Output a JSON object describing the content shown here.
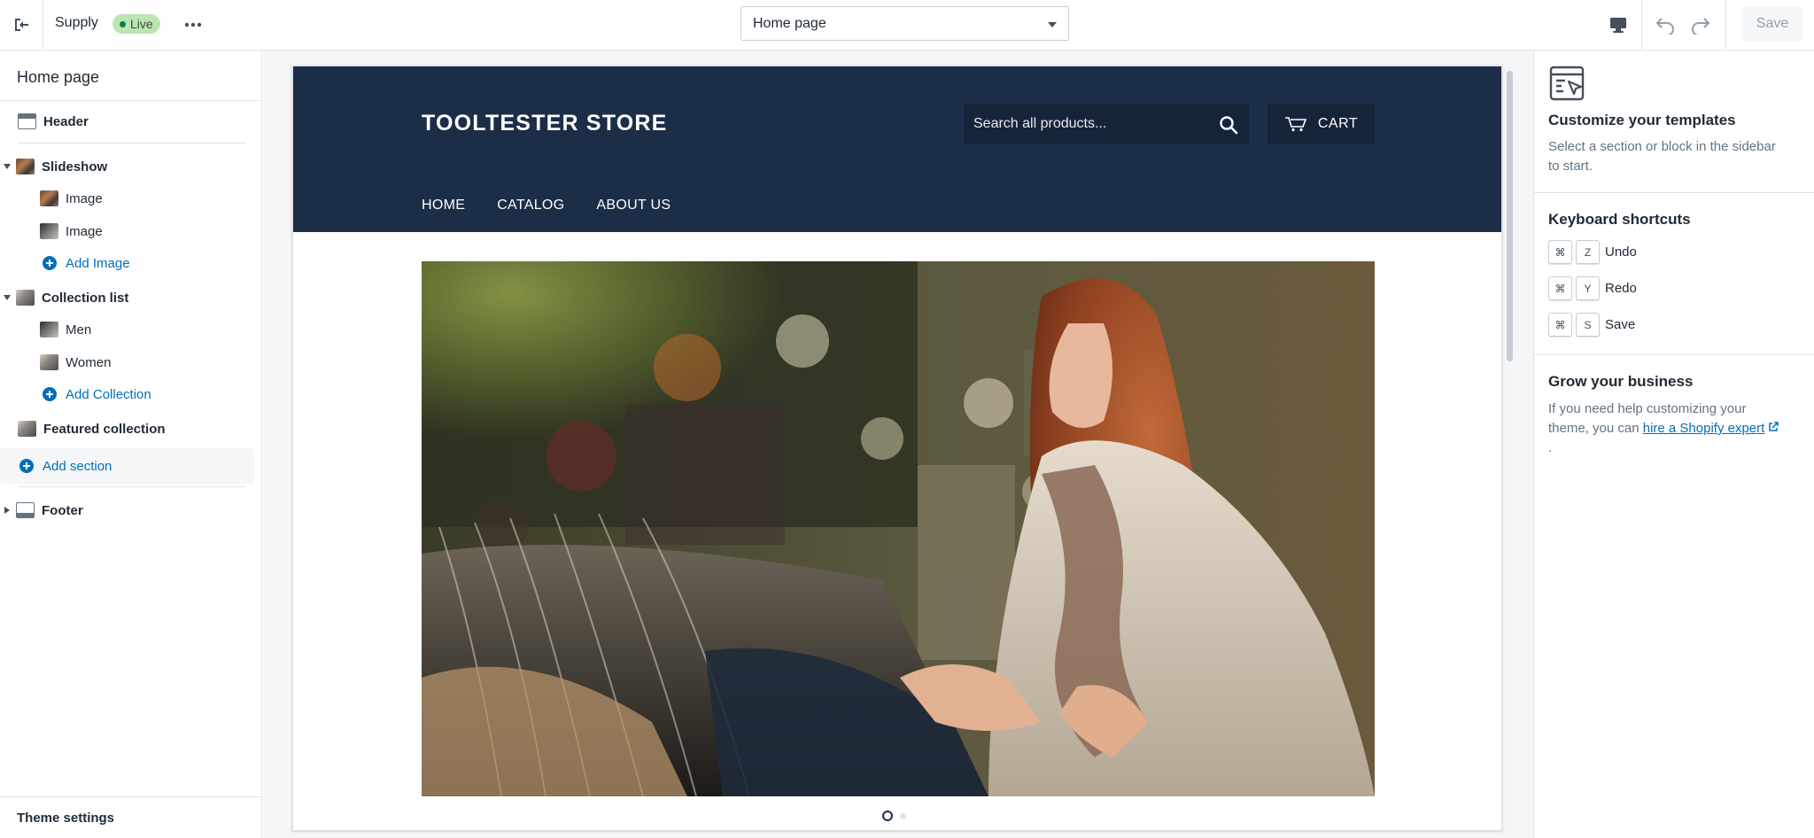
{
  "topbar": {
    "theme_name": "Supply",
    "status_badge": "Live",
    "page_select_value": "Home page",
    "save_label": "Save"
  },
  "sidebar": {
    "title": "Home page",
    "items": [
      {
        "label": "Header"
      },
      {
        "label": "Slideshow"
      },
      {
        "label": "Image"
      },
      {
        "label": "Image"
      },
      {
        "label": "Add Image"
      },
      {
        "label": "Collection list"
      },
      {
        "label": "Men"
      },
      {
        "label": "Women"
      },
      {
        "label": "Add Collection"
      },
      {
        "label": "Featured collection"
      },
      {
        "label": "Add section"
      },
      {
        "label": "Footer"
      }
    ],
    "theme_settings": "Theme settings"
  },
  "store": {
    "name": "TOOLTESTER STORE",
    "search_placeholder": "Search all products...",
    "cart_label": "CART",
    "nav": [
      "HOME",
      "CATALOG",
      "ABOUT US"
    ]
  },
  "right_panel": {
    "customize_title": "Customize your templates",
    "customize_text": "Select a section or block in the sidebar to start.",
    "shortcuts_title": "Keyboard shortcuts",
    "shortcuts": [
      {
        "mod": "⌘",
        "key": "Z",
        "label": "Undo"
      },
      {
        "mod": "⌘",
        "key": "Y",
        "label": "Redo"
      },
      {
        "mod": "⌘",
        "key": "S",
        "label": "Save"
      }
    ],
    "grow_title": "Grow your business",
    "grow_text": "If you need help customizing your theme, you can",
    "grow_link": "hire a Shopify expert",
    "grow_after": "."
  },
  "colors": {
    "store_header_bg": "#1c2d48",
    "link_blue": "#006fbb",
    "live_badge_bg": "#bbe5b3"
  }
}
